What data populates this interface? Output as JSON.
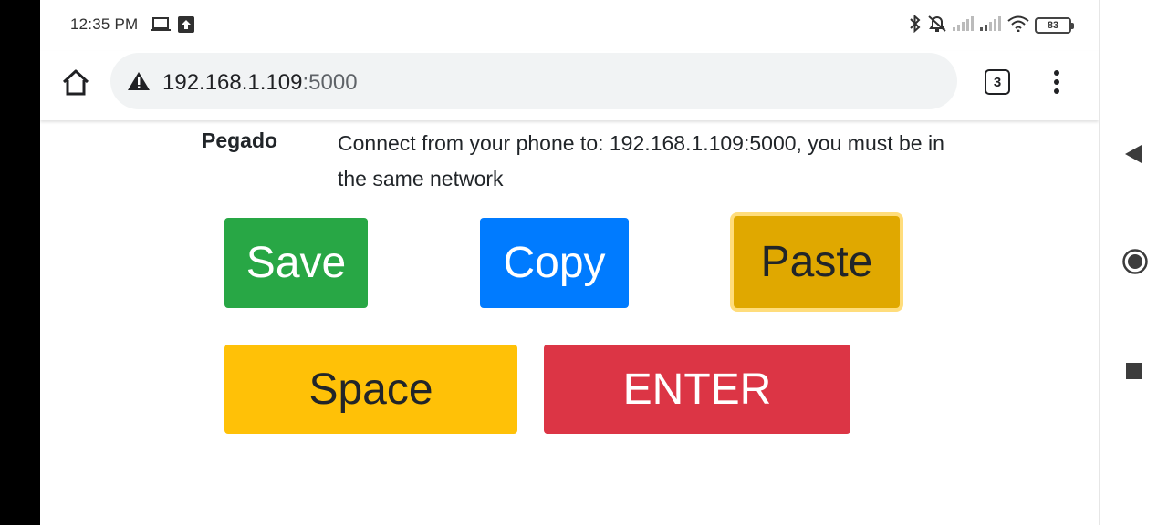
{
  "status_bar": {
    "time": "12:35 PM",
    "battery": "83",
    "icons": [
      "laptop-icon",
      "upload-icon",
      "bluetooth-icon",
      "alarm-off-icon",
      "signal-icon",
      "signal-icon",
      "wifi-icon",
      "battery-icon"
    ]
  },
  "browser": {
    "url_host": "192.168.1.109",
    "url_port": ":5000",
    "tab_count": "3",
    "icons": [
      "home-icon",
      "warning-icon",
      "more-vert-icon"
    ]
  },
  "page": {
    "label": "Pegado",
    "message": "Connect from your phone to: 192.168.1.109:5000, you must be in the same network",
    "buttons": {
      "save": "Save",
      "copy": "Copy",
      "paste": "Paste",
      "space": "Space",
      "enter": "ENTER"
    }
  },
  "colors": {
    "save": "#28a745",
    "copy": "#007bff",
    "paste": "#e0a800",
    "space": "#ffc107",
    "enter": "#dc3545"
  },
  "nav_bar": {
    "icons": [
      "back-icon",
      "home-circle-icon",
      "recents-icon"
    ]
  }
}
